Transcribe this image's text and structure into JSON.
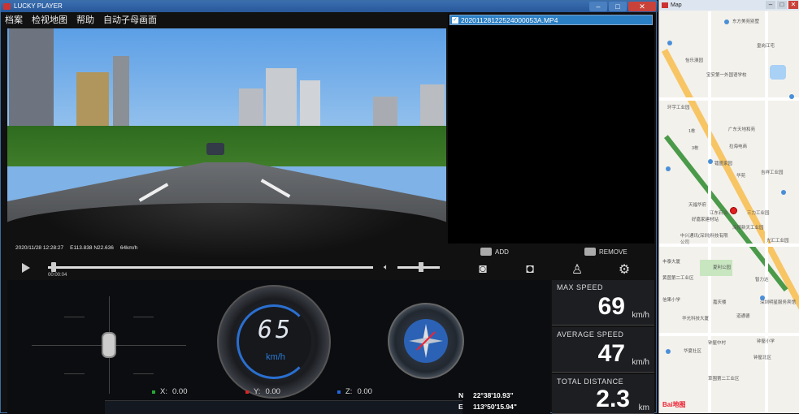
{
  "player": {
    "title": "LUCKY PLAYER",
    "menu": [
      "档案",
      "检视地图",
      "帮助",
      "自动子母画面"
    ]
  },
  "video": {
    "osd_datetime": "2020/11/28 12:28:27",
    "osd_gps": "E113.838 N22.636",
    "osd_speed": "64km/h"
  },
  "playlist": {
    "file": "20201128122524000053A.MP4",
    "add_label": "ADD",
    "remove_label": "REMOVE"
  },
  "playback": {
    "timecode": "00:00:04",
    "progress": 0.01,
    "volume": 0.55
  },
  "dashboard": {
    "speed": "65",
    "speed_unit": "km/h",
    "x_label": "X:",
    "x_value": "0.00",
    "y_label": "Y:",
    "y_value": "0.00",
    "z_label": "Z:",
    "z_value": "0.00",
    "lat_key": "N",
    "lat": "22°38'10.93\"",
    "lon_key": "E",
    "lon": "113°50'15.94\"",
    "colors": {
      "x": "#22aa33",
      "y": "#dd2222",
      "z": "#2266dd",
      "accent": "#2a7bd6"
    }
  },
  "stats": {
    "max_speed_label": "MAX SPEED",
    "max_speed": "69",
    "max_speed_unit": "km/h",
    "avg_speed_label": "AVERAGE SPEED",
    "avg_speed": "47",
    "avg_speed_unit": "km/h",
    "distance_label": "TOTAL DISTANCE",
    "distance": "2.3",
    "distance_unit": "km"
  },
  "map": {
    "title": "Map",
    "labels": [
      "东方美苑别墅",
      "皇岗江宅",
      "怡乐澳园",
      "宝安第一外国语学校",
      "环宇工业园",
      "1栋",
      "广东天地和苑",
      "3栋",
      "拉海电商",
      "镭盛家园",
      "吉祥工业园",
      "华苑",
      "天福华府",
      "江东石油",
      "三力工业园",
      "好嘉家建材站",
      "深报新天工业园",
      "中兴通讯(深圳)科技有限公司",
      "光汇工业园",
      "丰泰大厦",
      "夏利公园",
      "智力达",
      "黄茵第二工业区",
      "信果小学",
      "嘉庆楼",
      "深圳明星服务宾馆",
      "华光科技大厦",
      "道通德",
      "钟屋中村",
      "钟屋小学",
      "华夏社区",
      "钟屋北区",
      "草围第二工业区"
    ],
    "brand": "Bai地图"
  }
}
